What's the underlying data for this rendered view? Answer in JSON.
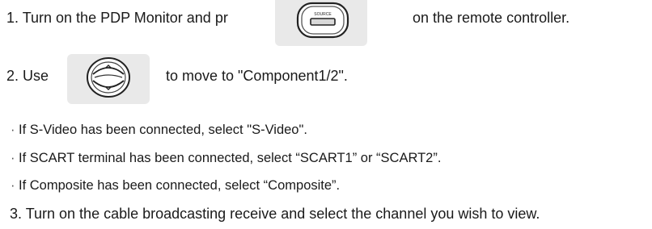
{
  "steps": {
    "step1": {
      "before": "1. Turn on the PDP Monitor and pr",
      "icon_label": "SOURCE",
      "after": "on the remote controller."
    },
    "step2": {
      "before": "2. Use",
      "after": "to move to \"Component1/2\"."
    },
    "step3": "3. Turn on the cable broadcasting receive and select the channel you wish to view."
  },
  "bullets": [
    "If S-Video has been connected, select \"S-Video\".",
    "If SCART terminal has been connected, select “SCART1” or “SCART2”.",
    "If Composite has been connected, select “Composite”."
  ],
  "bullet_marker": "·",
  "icons": {
    "source_button": "source-button-icon",
    "up_down_button": "up-down-arrows-icon"
  },
  "colors": {
    "text": "#1a1a1a",
    "tile": "#e9e9e9"
  }
}
